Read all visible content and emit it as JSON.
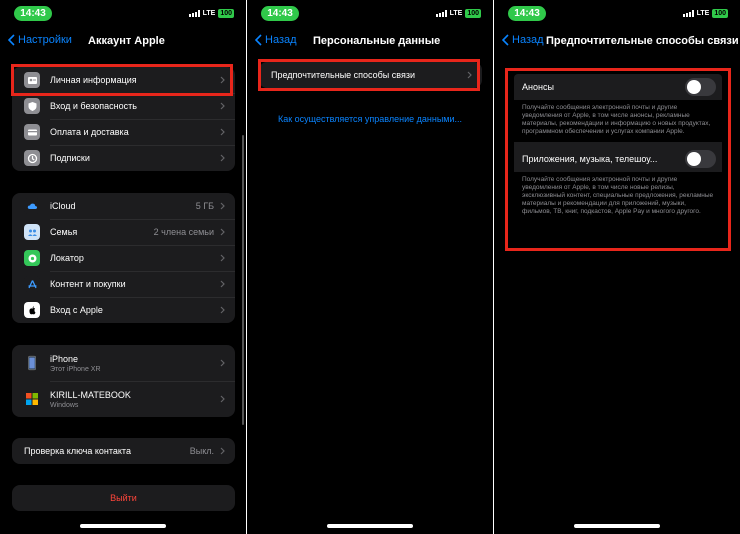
{
  "status": {
    "time": "14:43",
    "network": "LTE",
    "battery": "100"
  },
  "panel1": {
    "back_label": "Настройки",
    "title": "Аккаунт Apple",
    "group1": [
      {
        "label": "Личная информация",
        "icon": "person-card-icon"
      },
      {
        "label": "Вход и безопасность",
        "icon": "shield-icon"
      },
      {
        "label": "Оплата и доставка",
        "icon": "credit-card-icon"
      },
      {
        "label": "Подписки",
        "icon": "subscriptions-icon"
      }
    ],
    "group2": [
      {
        "label": "iCloud",
        "value": "5 ГБ",
        "icon": "cloud-icon"
      },
      {
        "label": "Семья",
        "value": "2 члена семьи",
        "icon": "family-icon"
      },
      {
        "label": "Локатор",
        "value": "",
        "icon": "find-my-icon"
      },
      {
        "label": "Контент и покупки",
        "value": "",
        "icon": "app-store-icon"
      },
      {
        "label": "Вход с Apple",
        "value": "",
        "icon": "apple-icon"
      }
    ],
    "devices": [
      {
        "name": "iPhone",
        "sub": "Этот iPhone XR",
        "icon": "iphone-icon"
      },
      {
        "name": "KIRILL-MATEBOOK",
        "sub": "Windows",
        "icon": "windows-icon"
      }
    ],
    "contact_key": {
      "label": "Проверка ключа контакта",
      "value": "Выкл."
    },
    "signout_label": "Выйти"
  },
  "panel2": {
    "back_label": "Назад",
    "title": "Персональные данные",
    "row_label": "Предпочтительные способы связи",
    "link_label": "Как осуществляется управление данными..."
  },
  "panel3": {
    "back_label": "Назад",
    "title": "Предпочтительные способы связи",
    "toggles": [
      {
        "label": "Анонсы",
        "on": false,
        "description": "Получайте сообщения электронной почты и другие уведомления от Apple, в том числе анонсы, рекламные материалы, рекомендации и информацию о новых продуктах, программном обеспечении и услугах компании Apple."
      },
      {
        "label": "Приложения, музыка, телешоу...",
        "on": false,
        "description": "Получайте сообщения электронной почты и другие уведомления от Apple, в том числе новые релизы, эксклюзивный контент, специальные предложения, рекламные материалы и рекомендации для приложений, музыки, фильмов, ТВ, книг, подкастов, Apple Pay и многого другого."
      }
    ]
  },
  "colors": {
    "accent": "#0a84ff",
    "highlight": "#e8261b",
    "time_pill": "#30c94a",
    "destructive": "#ff453a"
  }
}
